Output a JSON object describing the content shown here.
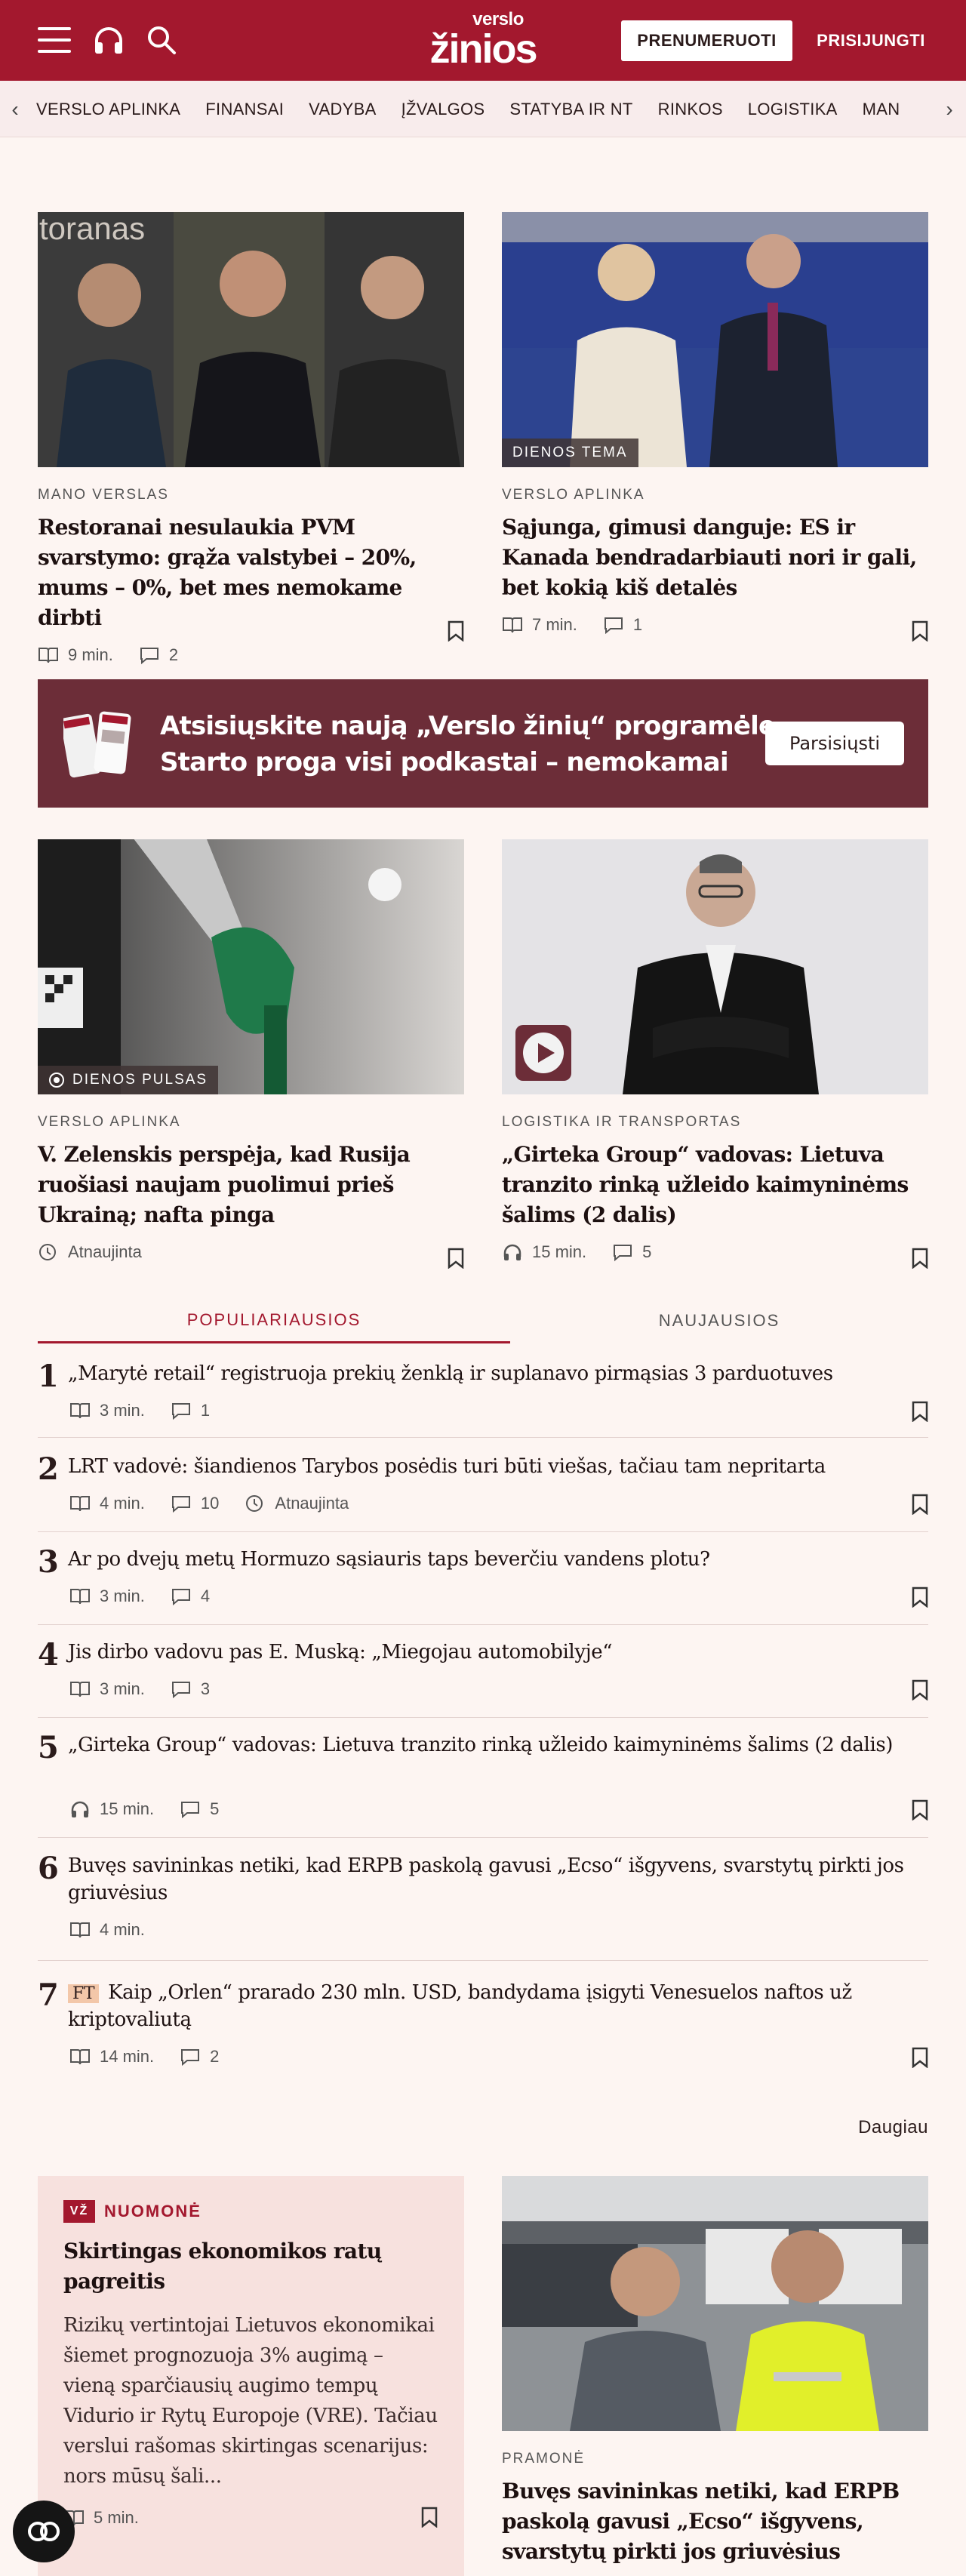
{
  "header": {
    "logo_top": "verslo",
    "logo_bottom": "žinios",
    "subscribe_label": "PRENUMERUOTI",
    "login_label": "PRISIJUNGTI"
  },
  "nav": {
    "items": [
      "VERSLO APLINKA",
      "FINANSAI",
      "VADYBA",
      "ĮŽVALGOS",
      "STATYBA IR NT",
      "RINKOS",
      "LOGISTIKA",
      "MAN"
    ]
  },
  "articles": [
    {
      "category": "MANO VERSLAS",
      "title": "Restoranai nesulaukia PVM svarstymo: grąža valstybei – 20%, mums – 0%, bet mes nemokame dirbti",
      "read": "9 min.",
      "comments": "2",
      "img_text": "toranas"
    },
    {
      "category": "VERSLO APLINKA",
      "title": "Sąjunga, gimusi danguje: ES ir Kanada bendradarbiauti nori ir gali, bet kokią kiš detalės",
      "read": "7 min.",
      "comments": "1",
      "badge": "DIENOS TEMA"
    },
    {
      "category": "VERSLO APLINKA",
      "title": "V. Zelenskis perspėja, kad Rusija ruošiasi naujam puolimui prieš Ukrainą; nafta pinga",
      "updated": "Atnaujinta",
      "badge": "DIENOS PULSAS"
    },
    {
      "category": "LOGISTIKA IR TRANSPORTAS",
      "title": "„Girteka Group“ vadovas: Lietuva tranzito rinką užleido kaimyninėms šalims (2 dalis)",
      "listen": "15 min.",
      "comments": "5"
    }
  ],
  "app_banner": {
    "line1": "Atsisiųskite naują „Verslo žinių“ programėlę.",
    "line2": "Starto proga visi podkastai – nemokamai",
    "button": "Parsisiųsti"
  },
  "tabs": {
    "popular": "POPULIARIAUSIOS",
    "latest": "NAUJAUSIOS"
  },
  "popular": [
    {
      "n": "1",
      "title": "„Marytė retail“ registruoja prekių ženklą ir suplanavo pirmąsias 3 parduotuves",
      "read": "3 min.",
      "comments": "1"
    },
    {
      "n": "2",
      "title": "LRT vadovė: šiandienos Tarybos posėdis turi būti viešas, tačiau tam nepritarta",
      "read": "4 min.",
      "comments": "10",
      "updated": "Atnaujinta"
    },
    {
      "n": "3",
      "title": "Ar po dvejų metų Hormuzo sąsiauris taps beverčiu vandens plotu?",
      "read": "3 min.",
      "comments": "4"
    },
    {
      "n": "4",
      "title": "Jis dirbo vadovu pas E. Muską: „Miegojau automobilyje“",
      "read": "3 min.",
      "comments": "3"
    },
    {
      "n": "5",
      "title": "„Girteka Group“ vadovas: Lietuva tranzito rinką užleido kaimyninėms šalims (2 dalis)",
      "listen": "15 min.",
      "comments": "5"
    },
    {
      "n": "6",
      "title": "Buvęs savininkas netiki, kad ERPB paskolą gavusi „Ecso“ išgyvens, svarstytų pirkti jos griuvėsius",
      "read": "4 min."
    },
    {
      "n": "7",
      "ft": "FT",
      "title": "Kaip „Orlen“ prarado 230 mln. USD, bandydama įsigyti Venesuelos naftos už kriptovaliutą",
      "read": "14 min.",
      "comments": "2"
    }
  ],
  "more_label": "Daugiau",
  "opinion": {
    "logo": "VŽ",
    "label": "NUOMONĖ",
    "title": "Skirtingas ekonomikos ratų pagreitis",
    "text": "Rizikų vertintojai Lietuvos ekonomikai šiemet prognozuoja 3% augimą – vieną sparčiausių augimo tempų Vidurio ir Rytų Europoje (VRE). Tačiau verslui rašomas skirtingas scenarijus: nors mūsų šali...",
    "read": "5 min."
  },
  "bottom_article": {
    "category": "PRAMONĖ",
    "title": "Buvęs savininkas netiki, kad ERPB paskolą gavusi „Ecso“ išgyvens, svarstytų pirkti jos griuvėsius"
  },
  "colors": {
    "brand": "#a3182e",
    "background": "#fdf5f2",
    "banner": "#6c2d38"
  }
}
